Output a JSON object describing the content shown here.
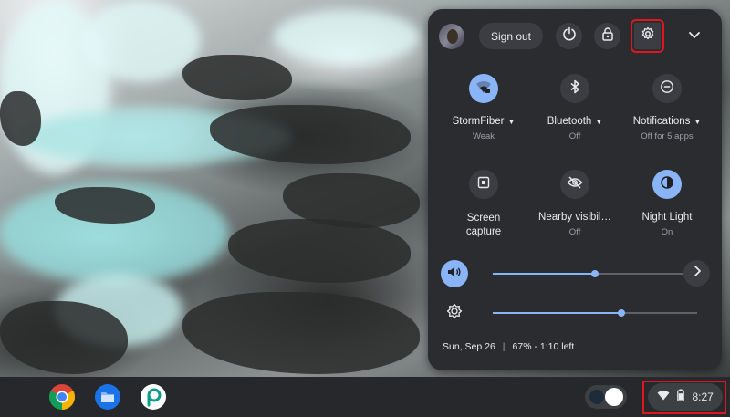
{
  "quick_settings": {
    "sign_out_label": "Sign out",
    "icons": {
      "power": "power-icon",
      "lock": "lock-icon",
      "settings": "gear-icon",
      "collapse": "chevron-down-icon"
    },
    "tiles": [
      {
        "label": "StormFiber",
        "sub": "Weak",
        "active": true,
        "has_menu": true,
        "icon": "wifi-icon"
      },
      {
        "label": "Bluetooth",
        "sub": "Off",
        "active": false,
        "has_menu": true,
        "icon": "bluetooth-icon"
      },
      {
        "label": "Notifications",
        "sub": "Off for 5 apps",
        "active": false,
        "has_menu": true,
        "icon": "do-not-disturb-icon"
      },
      {
        "label": "Screen\ncapture",
        "sub": "",
        "active": false,
        "has_menu": false,
        "icon": "screen-capture-icon"
      },
      {
        "label": "Nearby visibil…",
        "sub": "Off",
        "active": false,
        "has_menu": false,
        "icon": "eye-off-icon"
      },
      {
        "label": "Night Light",
        "sub": "On",
        "active": true,
        "has_menu": false,
        "icon": "night-light-icon"
      }
    ],
    "volume": {
      "level": 0.5,
      "icon": "volume-icon"
    },
    "brightness": {
      "level": 0.63,
      "icon": "brightness-icon"
    },
    "date": "Sun, Sep 26",
    "battery_status": "67% - 1:10 left"
  },
  "shelf": {
    "apps": [
      {
        "name": "Chrome",
        "icon": "chrome-icon"
      },
      {
        "name": "Files",
        "icon": "files-folder-icon"
      },
      {
        "name": "PicsArt",
        "icon": "picsart-icon"
      }
    ],
    "clock": "8:27"
  },
  "colors": {
    "accent": "#8ab4f8",
    "panel": "#2b2c30",
    "highlight": "#e0161e"
  }
}
